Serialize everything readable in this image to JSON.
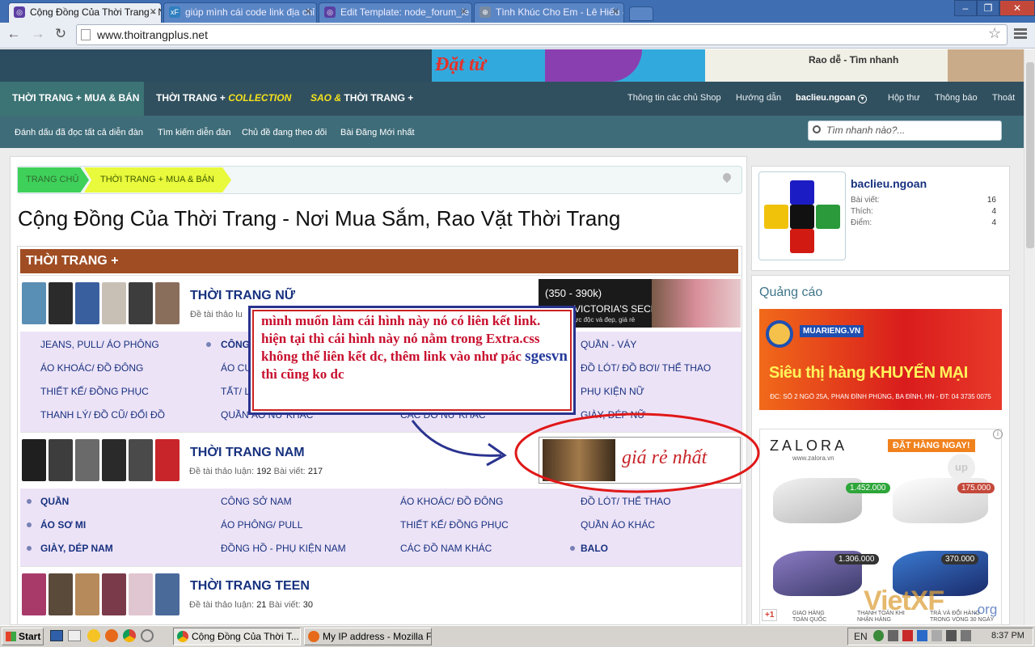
{
  "browser": {
    "tabs": [
      {
        "title": "Cộng Đồng Của Thời Trang - N"
      },
      {
        "title": "giúp mình cái code link địa chỉ"
      },
      {
        "title": "Edit Template: node_forum_le"
      },
      {
        "title": "Tình Khúc Cho Em - Lê Hiếu -"
      }
    ],
    "url": "www.thoitrangplus.net"
  },
  "site": {
    "banner_text": "Rao dễ - Tìm nhanh",
    "banner_slogan": "Đặt từ",
    "nav_main": [
      "THỜI TRANG + MUA & BÁN"
    ],
    "nav_collection": {
      "prefix": "THỜI TRANG +",
      "highlight": "COLLECTION"
    },
    "nav_sao": {
      "highlight": "SAO &",
      "suffix": "THỜI TRANG +"
    },
    "nav_right": [
      "Thông tin các chủ Shop",
      "Hướng dẫn",
      "baclieu.ngoan",
      "Hộp thư",
      "Thông báo",
      "Thoát"
    ],
    "nav_sub": [
      "Đánh dấu đã đọc tất cả diễn đàn",
      "Tìm kiếm diễn đàn",
      "Chủ đề đang theo dõi",
      "Bài Đăng Mới nhất"
    ],
    "search_placeholder": "Tìm nhanh nào?...",
    "breadcrumb": [
      "TRANG CHỦ",
      "THỜI TRANG + MUA & BÁN"
    ],
    "page_title": "Cộng Đồng Của Thời Trang - Nơi Mua Sắm, Rao Vặt Thời Trang",
    "category": "THỜI TRANG +",
    "forums": [
      {
        "title": "THỜI TRANG NỮ",
        "stats_label": "Đề tài thảo lu"
      },
      {
        "title": "THỜI TRANG NAM",
        "topics_label": "Đề tài thảo luận:",
        "topics": "192",
        "posts_label": "Bài viết:",
        "posts": "217"
      },
      {
        "title": "THỜI TRANG TEEN",
        "topics_label": "Đề tài thảo luận:",
        "topics": "21",
        "posts_label": "Bài viết:",
        "posts": "30"
      }
    ],
    "subforums_nu": [
      [
        "JEANS, PULL/ ÁO PHÔNG",
        "CÔNG S",
        "",
        "QUẦN - VÁY"
      ],
      [
        "ÁO KHOÁC/ ĐỒ ĐÔNG",
        "ÁO CƯ",
        "",
        "ĐỒ LÓT/ ĐỒ BƠI/ THỂ THAO"
      ],
      [
        "THIẾT KẾ/ ĐỒNG PHỤC",
        "TẤT/ LE",
        "",
        "PHỤ KIỆN NỮ"
      ],
      [
        "THANH LÝ/ ĐỒ CŨ/ ĐỔI ĐỒ",
        "QUẦN ÁO NỮ KHÁC",
        "CÁC ĐỒ NỮ KHÁC",
        "GIÀY, DÉP NỮ"
      ]
    ],
    "subforums_nam": [
      [
        "QUẦN",
        "CÔNG SỞ NAM",
        "ÁO KHOÁC/ ĐỒ ĐÔNG",
        "ĐỒ LÓT/ THỂ THAO"
      ],
      [
        "ÁO SƠ MI",
        "ÁO PHÔNG/ PULL",
        "THIẾT KẾ/ ĐỒNG PHỤC",
        "QUẦN ÁO KHÁC"
      ],
      [
        "GIÀY, DÉP NAM",
        "ĐỒNG HỒ - PHỤ KIỆN NAM",
        "CÁC ĐỒ NAM KHÁC",
        "BALO"
      ]
    ],
    "vs_ad": {
      "price": "(350 - 390k)",
      "brand": "VICTORIA'S SECRET",
      "tagline": "ực độc và đẹp, giá rẻ"
    },
    "watch_ad": "giá rẻ nhất",
    "profile": {
      "name": "baclieu.ngoan",
      "rows": [
        {
          "label": "Bài viết:",
          "value": "16"
        },
        {
          "label": "Thích:",
          "value": "4"
        },
        {
          "label": "Điểm:",
          "value": "4"
        }
      ]
    },
    "ads_title": "Quảng cáo",
    "ad1": {
      "brand": "MUARIENG.VN",
      "headline": "Siêu thị hàng KHUYẾN MẠI",
      "address": "ĐC: SỐ 2 NGÕ 25A, PHAN ĐÌNH PHÙNG, BA ĐÌNH, HN - ĐT: 04 3735 0075"
    },
    "ad2": {
      "brand": "ZALORA",
      "site": "www.zalora.vn",
      "cta": "ĐẶT HÀNG NGAY!",
      "prices": [
        "1.452.000",
        "175.000",
        "1.306.000",
        "370.000"
      ],
      "badge": "+1",
      "footer": [
        "GIAO HÀNG TOÀN QUỐC",
        "THANH TOÁN KHI NHẬN HÀNG",
        "TRẢ VÀ ĐỔI HÀNG TRONG VÒNG 30 NGÀY"
      ],
      "up": "up"
    },
    "watermark": "VietXF",
    "watermark_tld": ".org"
  },
  "annotation": {
    "text_1": "mình muốn làm cái hình này nó có liên kết link. hiện tại thì cái hình này nó nằm trong Extra.css không thể liên kết dc, thêm link vào như pác",
    "highlight": "sgesvn",
    "text_2": "thì cũng ko dc"
  },
  "taskbar": {
    "start": "Start",
    "buttons": [
      "Cộng Đồng Của Thời T...",
      "My IP address - Mozilla Fi..."
    ],
    "lang": "EN",
    "clock": "8:37 PM"
  }
}
